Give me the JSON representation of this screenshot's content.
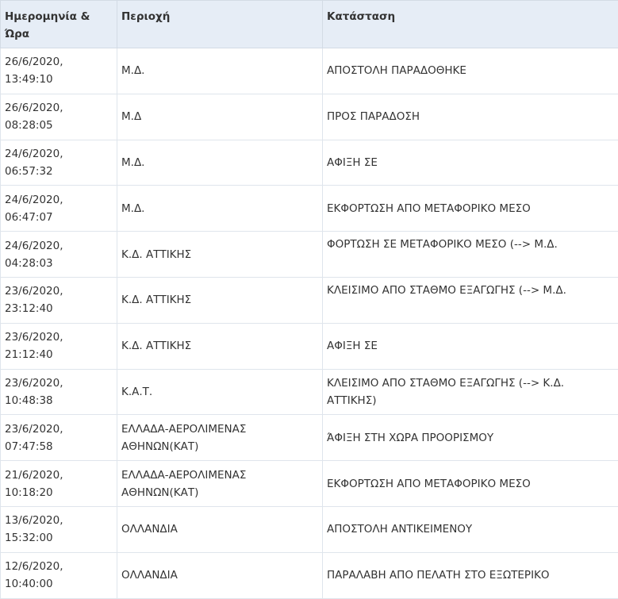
{
  "table": {
    "headers": {
      "datetime": "Ημερομηνία & Ώρα",
      "area": "Περιοχή",
      "status": "Κατάσταση"
    },
    "rows": [
      {
        "date": "26/6/2020,",
        "time": "13:49:10",
        "area": "Μ.Δ.",
        "status": "ΑΠΟΣΤΟΛΗ ΠΑΡΑΔΟΘΗΚΕ"
      },
      {
        "date": "26/6/2020,",
        "time": "08:28:05",
        "area": "Μ.Δ",
        "status": "ΠΡΟΣ ΠΑΡΑΔΟΣΗ"
      },
      {
        "date": "24/6/2020,",
        "time": "06:57:32",
        "area": "Μ.Δ.",
        "status": "ΑΦΙΞΗ ΣΕ"
      },
      {
        "date": "24/6/2020,",
        "time": "06:47:07",
        "area": "Μ.Δ.",
        "status": "ΕΚΦΟΡΤΩΣΗ ΑΠΟ ΜΕΤΑΦΟΡΙΚΟ ΜΕΣΟ"
      },
      {
        "date": "24/6/2020,",
        "time": "04:28:03",
        "area": "Κ.Δ. ΑΤΤΙΚΗΣ",
        "status": "ΦΟΡΤΩΣΗ ΣΕ ΜΕΤΑΦΟΡΙΚΟ ΜΕΣΟ (--> Μ.Δ."
      },
      {
        "date": "23/6/2020,",
        "time": "23:12:40",
        "area": "Κ.Δ. ΑΤΤΙΚΗΣ",
        "status": "ΚΛΕΙΣΙΜΟ ΑΠΟ ΣΤΑΘΜΟ ΕΞΑΓΩΓΗΣ (--> Μ.Δ."
      },
      {
        "date": "23/6/2020,",
        "time": "21:12:40",
        "area": "Κ.Δ. ΑΤΤΙΚΗΣ",
        "status": "ΑΦΙΞΗ ΣΕ"
      },
      {
        "date": "23/6/2020,",
        "time": "10:48:38",
        "area": "Κ.Α.Τ.",
        "status": "ΚΛΕΙΣΙΜΟ ΑΠΟ ΣΤΑΘΜΟ ΕΞΑΓΩΓΗΣ (--> Κ.Δ. ΑΤΤΙΚΗΣ)"
      },
      {
        "date": "23/6/2020,",
        "time": "07:47:58",
        "area": "ΕΛΛΑΔΑ-ΑΕΡΟΛΙΜΕΝΑΣ ΑΘΗΝΩΝ(ΚΑΤ)",
        "status": "ΆΦΙΞΗ ΣΤΗ ΧΩΡΑ ΠΡΟΟΡΙΣΜΟΥ"
      },
      {
        "date": "21/6/2020,",
        "time": "10:18:20",
        "area": "ΕΛΛΑΔΑ-ΑΕΡΟΛΙΜΕΝΑΣ ΑΘΗΝΩΝ(ΚΑΤ)",
        "status": "ΕΚΦΟΡΤΩΣΗ ΑΠΟ ΜΕΤΑΦΟΡΙΚΟ ΜΕΣΟ"
      },
      {
        "date": "13/6/2020,",
        "time": "15:32:00",
        "area": "ΟΛΛΑΝΔΙΑ",
        "status": "ΑΠΟΣΤΟΛΗ ΑΝΤΙΚΕΙΜΕΝΟΥ"
      },
      {
        "date": "12/6/2020,",
        "time": "10:40:00",
        "area": "ΟΛΛΑΝΔΙΑ",
        "status": "ΠΑΡΑΛΑΒΗ ΑΠΟ ΠΕΛΑΤΗ ΣΤΟ ΕΞΩΤΕΡΙΚΟ"
      }
    ]
  }
}
